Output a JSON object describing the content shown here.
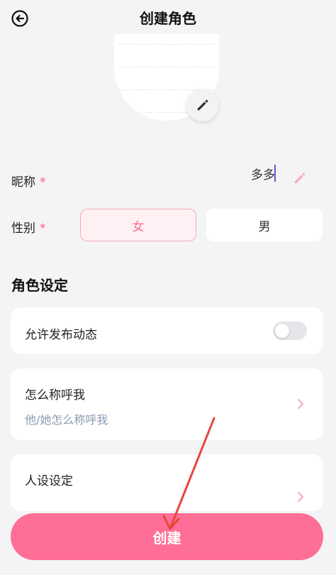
{
  "header": {
    "title": "创建角色"
  },
  "form": {
    "nickname_label": "昵称",
    "nickname_value": "多多",
    "gender_label": "性别",
    "required_mark": "*",
    "gender_options": [
      "女",
      "男"
    ],
    "gender_selected": "女"
  },
  "role_settings": {
    "title": "角色设定",
    "allow_post_label": "允许发布动态",
    "allow_post_enabled": false,
    "call_me_label": "怎么称呼我",
    "call_me_placeholder": "他/她怎么称呼我",
    "persona_label": "人设设定"
  },
  "create_button_label": "创建",
  "colors": {
    "accent": "#ff6e96",
    "required": "#ff5a7e",
    "selected_border": "#f7a9b9",
    "selected_text": "#ff6b8c",
    "annotation_arrow": "#e8453c"
  }
}
